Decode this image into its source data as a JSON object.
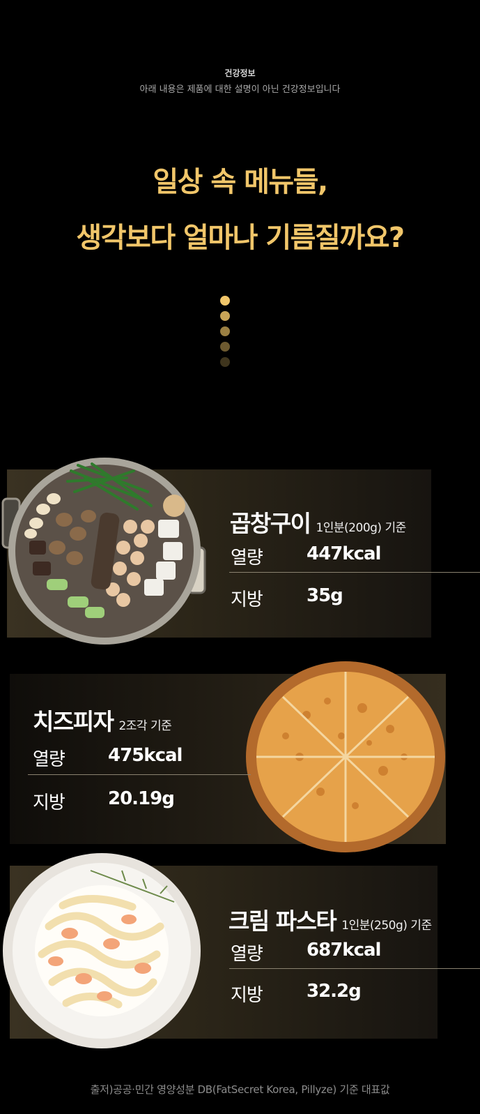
{
  "header": {
    "title": "건강정보",
    "subtitle": "아래 내용은 제품에 대한 설명이 아닌 건강정보입니다"
  },
  "headline": {
    "line1": "일상 속 메뉴들,",
    "line2": "생각보다 얼마나 기름질까요?",
    "color": "#f1c66a"
  },
  "dots": [
    "#f1c66a",
    "#c9a457",
    "#9b8043",
    "#6d5a30",
    "#3f351d"
  ],
  "foods": [
    {
      "name": "곱창구이",
      "basis": "1인분(200g) 기준",
      "calorie_label": "열량",
      "calorie_value": "447kcal",
      "fat_label": "지방",
      "fat_value": "35g",
      "image": "gopchang-grill-image"
    },
    {
      "name": "치즈피자",
      "basis": "2조각 기준",
      "calorie_label": "열량",
      "calorie_value": "475kcal",
      "fat_label": "지방",
      "fat_value": "20.19g",
      "image": "cheese-pizza-image"
    },
    {
      "name": "크림 파스타",
      "basis": "1인분(250g) 기준",
      "calorie_label": "열량",
      "calorie_value": "687kcal",
      "fat_label": "지방",
      "fat_value": "32.2g",
      "image": "cream-pasta-image"
    }
  ],
  "source": "출저)공공·민간 영양성분 DB(FatSecret Korea, Pillyze) 기준 대표값"
}
